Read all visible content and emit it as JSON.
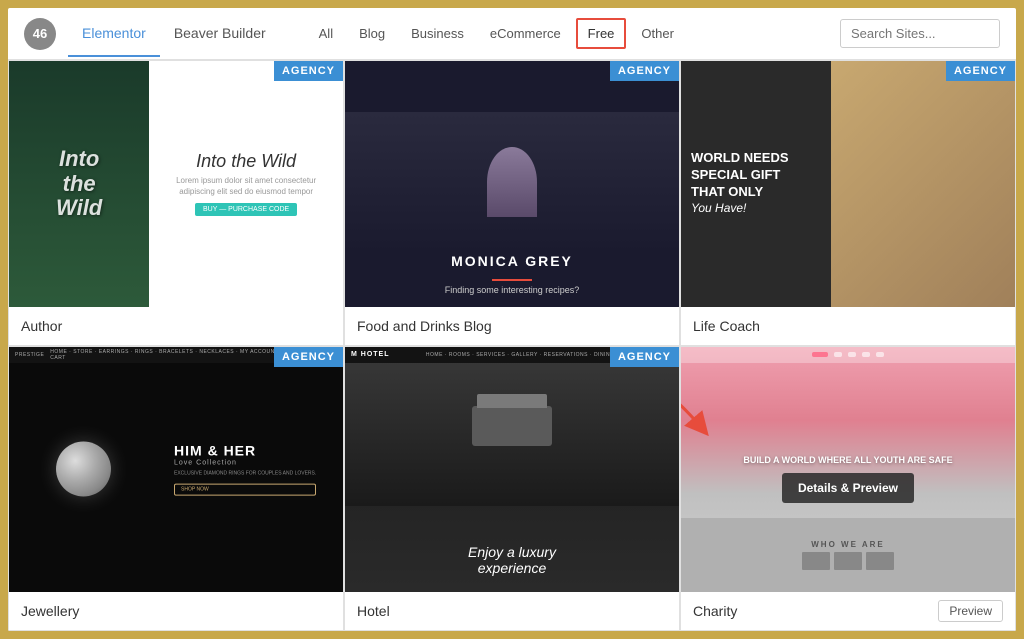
{
  "header": {
    "count": "46",
    "tabs": [
      {
        "label": "Elementor",
        "active": true
      },
      {
        "label": "Beaver Builder",
        "active": false
      }
    ],
    "filters": [
      {
        "label": "All"
      },
      {
        "label": "Blog"
      },
      {
        "label": "Business"
      },
      {
        "label": "eCommerce"
      },
      {
        "label": "Free",
        "highlight": true
      },
      {
        "label": "Other"
      }
    ],
    "search_placeholder": "Search Sites..."
  },
  "cards": [
    {
      "id": "author",
      "badge": "AGENCY",
      "title": "Author",
      "preview": false,
      "type": "author"
    },
    {
      "id": "food",
      "badge": "AGENCY",
      "title": "Food and Drinks Blog",
      "preview": false,
      "type": "food"
    },
    {
      "id": "life-coach",
      "badge": "AGENCY",
      "title": "Life Coach",
      "preview": false,
      "type": "life"
    },
    {
      "id": "jewellery",
      "badge": "AGENCY",
      "title": "Jewellery",
      "preview": false,
      "type": "jewel"
    },
    {
      "id": "hotel",
      "badge": "AGENCY",
      "title": "Hotel",
      "preview": false,
      "type": "hotel"
    },
    {
      "id": "charity",
      "badge": "",
      "title": "Charity",
      "preview": true,
      "type": "charity",
      "cta": "Details & Preview",
      "who": "WHO WE ARE"
    }
  ],
  "icons": {
    "search": "🔍"
  }
}
